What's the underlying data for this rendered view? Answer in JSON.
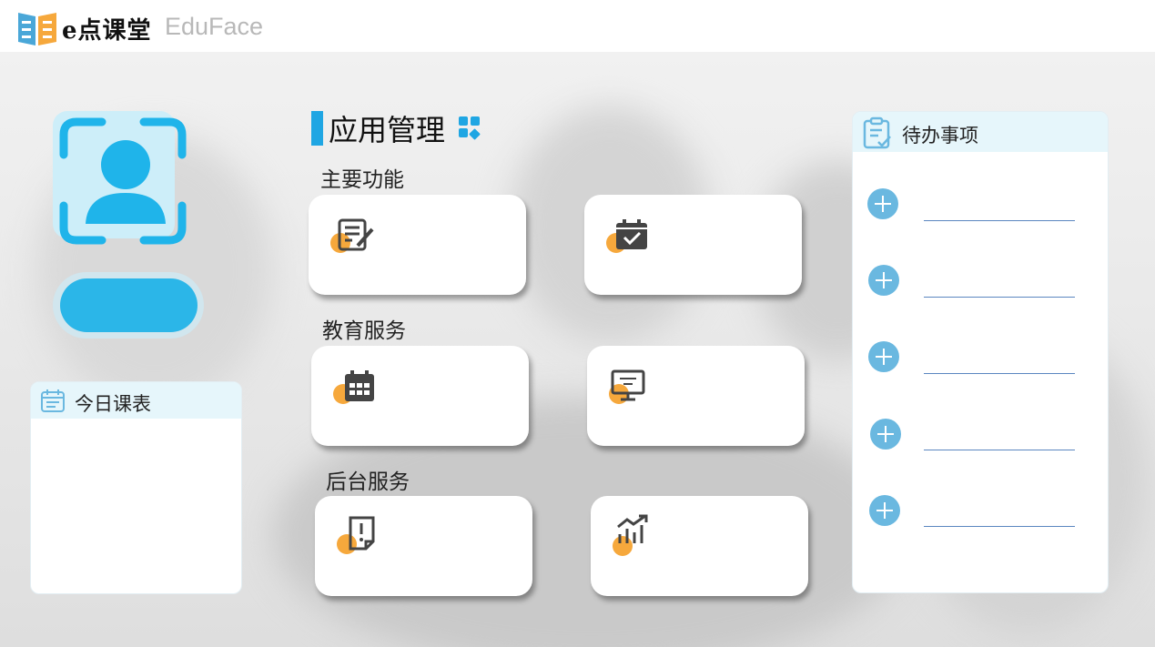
{
  "header": {
    "brand_name": "e点课堂",
    "brand_sub": "EduFace",
    "colors": {
      "logo_blue": "#4aa7d8",
      "logo_orange": "#f6a83c"
    }
  },
  "profile": {
    "avatar_icon": "user-face-scan-icon",
    "login_button_label": "",
    "colors": {
      "accent": "#2bb6e8"
    }
  },
  "schedule": {
    "title": "今日课表",
    "icon": "calendar-icon"
  },
  "app_management": {
    "title": "应用管理",
    "title_icon": "apps-grid-icon",
    "groups": [
      {
        "label": "主要功能",
        "cards": [
          {
            "icon": "edit-document-icon",
            "label": ""
          },
          {
            "icon": "calendar-check-icon",
            "label": ""
          }
        ]
      },
      {
        "label": "教育服务",
        "cards": [
          {
            "icon": "calendar-grid-icon",
            "label": ""
          },
          {
            "icon": "presentation-board-icon",
            "label": ""
          }
        ]
      },
      {
        "label": "后台服务",
        "cards": [
          {
            "icon": "alert-file-icon",
            "label": ""
          },
          {
            "icon": "growth-chart-icon",
            "label": ""
          }
        ]
      }
    ],
    "colors": {
      "bar": "#1fa6e3",
      "dot": "#f6a83c",
      "icon": "#444444"
    }
  },
  "todo": {
    "title": "待办事项",
    "icon": "clipboard-check-icon",
    "items": [
      "",
      "",
      "",
      "",
      ""
    ],
    "colors": {
      "plus": "#6ab8e0",
      "line": "#5a86c0"
    }
  }
}
